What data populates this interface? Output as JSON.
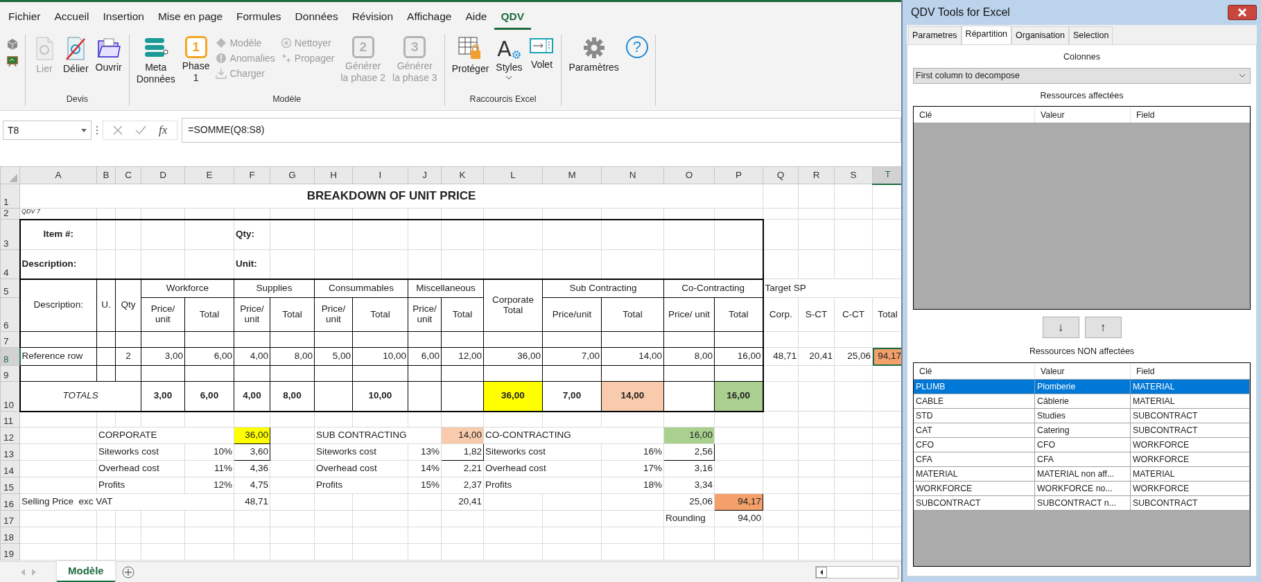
{
  "menu_tabs": [
    {
      "label": "Fichier",
      "selected": false
    },
    {
      "label": "Accueil",
      "selected": false
    },
    {
      "label": "Insertion",
      "selected": false
    },
    {
      "label": "Mise en page",
      "selected": false
    },
    {
      "label": "Formules",
      "selected": false
    },
    {
      "label": "Données",
      "selected": false
    },
    {
      "label": "Révision",
      "selected": false
    },
    {
      "label": "Affichage",
      "selected": false
    },
    {
      "label": "Aide",
      "selected": false
    },
    {
      "label": "QDV",
      "selected": true
    }
  ],
  "ribbon": {
    "groups": [
      {
        "buttons": [
          {
            "kind": "tiny",
            "disabled": false
          },
          {
            "kind": "tiny",
            "disabled": false
          }
        ]
      },
      {
        "label": "Devis",
        "buttons": [
          {
            "kind": "large",
            "label": "Lier",
            "disabled": true
          },
          {
            "kind": "large",
            "label": "Délier",
            "disabled": false
          },
          {
            "kind": "large",
            "label": "Ouvrir",
            "disabled": false
          }
        ]
      },
      {
        "label": "Modèle",
        "buttons": [
          {
            "kind": "large",
            "label": "Meta\nDonnées",
            "disabled": false
          },
          {
            "kind": "large",
            "label": "Phase\n1",
            "glyph": "1",
            "disabled": false
          },
          {
            "kind": "small",
            "label": "Modèle",
            "disabled": true
          },
          {
            "kind": "small",
            "label": "Anomalies",
            "disabled": true
          },
          {
            "kind": "small",
            "label": "Charger",
            "disabled": true
          },
          {
            "kind": "small",
            "label": "Nettoyer",
            "disabled": true
          },
          {
            "kind": "small",
            "label": "Propager",
            "disabled": true
          },
          {
            "kind": "large",
            "label": "Générer\nla phase 2",
            "glyph": "2",
            "disabled": true
          },
          {
            "kind": "large",
            "label": "Générer\nla phase 3",
            "glyph": "3",
            "disabled": true
          }
        ]
      },
      {
        "label": "Raccourcis Excel",
        "buttons": [
          {
            "kind": "large",
            "label": "Protéger",
            "disabled": false
          },
          {
            "kind": "large",
            "label": "Styles",
            "glyph": "A",
            "dropdown": true,
            "disabled": false
          },
          {
            "kind": "large",
            "label": "Volet",
            "disabled": false
          }
        ]
      },
      {
        "buttons": [
          {
            "kind": "large",
            "label": "Paramètres",
            "disabled": false
          },
          {
            "kind": "large",
            "glyph": "?",
            "disabled": false
          }
        ]
      }
    ]
  },
  "formula_bar": {
    "name_box": "T8",
    "function_label": "fx",
    "formula": "=SOMME(Q8:S8)"
  },
  "sheet": {
    "columns": [
      {
        "label": "A",
        "selected": false
      },
      {
        "label": "B",
        "selected": false
      },
      {
        "label": "C",
        "selected": false
      },
      {
        "label": "D",
        "selected": false
      },
      {
        "label": "E",
        "selected": false
      },
      {
        "label": "F",
        "selected": false
      },
      {
        "label": "G",
        "selected": false
      },
      {
        "label": "H",
        "selected": false
      },
      {
        "label": "I",
        "selected": false
      },
      {
        "label": "J",
        "selected": false
      },
      {
        "label": "K",
        "selected": false
      },
      {
        "label": "L",
        "selected": false
      },
      {
        "label": "M",
        "selected": false
      },
      {
        "label": "N",
        "selected": false
      },
      {
        "label": "O",
        "selected": false
      },
      {
        "label": "P",
        "selected": false
      },
      {
        "label": "Q",
        "selected": false
      },
      {
        "label": "R",
        "selected": false
      },
      {
        "label": "S",
        "selected": false
      },
      {
        "label": "T",
        "selected": true
      }
    ],
    "rows": [
      {
        "label": "1",
        "kind": "title",
        "selected": false,
        "cells": [
          {
            "text": "BREAKDOWN OF UNIT PRICE",
            "kind": "heading",
            "bold": true
          }
        ]
      },
      {
        "label": "2",
        "kind": "note",
        "selected": false,
        "cells": [
          {
            "text": "QDV 7",
            "kind": "label",
            "italic": true
          }
        ]
      },
      {
        "label": "3",
        "kind": "form",
        "selected": false,
        "cells": [
          {
            "text": "Item #:",
            "kind": "caption",
            "bold": true
          },
          "",
          "",
          "",
          "",
          {
            "text": "Qty:",
            "kind": "label",
            "bold": true
          }
        ]
      },
      {
        "label": "4",
        "kind": "form",
        "selected": false,
        "cells": [
          {
            "text": "Description:",
            "kind": "label",
            "bold": true
          },
          "",
          "",
          "",
          "",
          {
            "text": "Unit:",
            "kind": "label",
            "bold": true
          }
        ]
      },
      {
        "label": "5",
        "kind": "header",
        "selected": false,
        "cells": [
          {
            "text": "Description:",
            "kind": "heading"
          },
          {
            "text": "U.",
            "kind": "heading"
          },
          {
            "text": "Qty",
            "kind": "heading"
          },
          {
            "text": "Workforce",
            "kind": "heading"
          },
          "",
          {
            "text": "Supplies",
            "kind": "heading"
          },
          "",
          {
            "text": "Consummables",
            "kind": "heading"
          },
          "",
          {
            "text": "Miscellaneous",
            "kind": "heading"
          },
          "",
          {
            "text": "Corporate Total",
            "kind": "heading"
          },
          {
            "text": "Sub Contracting",
            "kind": "heading"
          },
          "",
          {
            "text": "Co-Contracting",
            "kind": "heading"
          },
          "",
          "Target SP"
        ]
      },
      {
        "label": "6",
        "kind": "header",
        "selected": false,
        "cells": [
          "",
          "",
          "",
          {
            "text": "Price/ unit",
            "kind": "heading"
          },
          {
            "text": "Total",
            "kind": "heading"
          },
          {
            "text": "Price/ unit",
            "kind": "heading"
          },
          {
            "text": "Total",
            "kind": "heading"
          },
          {
            "text": "Price/ unit",
            "kind": "heading"
          },
          {
            "text": "Total",
            "kind": "heading"
          },
          {
            "text": "Price/ unit",
            "kind": "heading"
          },
          {
            "text": "Total",
            "kind": "heading"
          },
          "",
          {
            "text": "Price/unit",
            "kind": "heading"
          },
          {
            "text": "Total",
            "kind": "heading"
          },
          {
            "text": "Price/ unit",
            "kind": "heading"
          },
          {
            "text": "Total",
            "kind": "heading"
          },
          {
            "text": "Corp.",
            "kind": "heading"
          },
          {
            "text": "S-CT",
            "kind": "heading"
          },
          {
            "text": "C-CT",
            "kind": "heading"
          },
          {
            "text": "Total",
            "kind": "heading"
          }
        ]
      },
      {
        "label": "7",
        "kind": "blank",
        "selected": false
      },
      {
        "label": "8",
        "kind": "data",
        "selected": true,
        "cells": [
          "Reference row",
          "",
          {
            "text": "2",
            "kind": "caption"
          },
          {
            "text": "3,00",
            "kind": "number"
          },
          {
            "text": "6,00",
            "kind": "number"
          },
          {
            "text": "4,00",
            "kind": "number"
          },
          {
            "text": "8,00",
            "kind": "number"
          },
          {
            "text": "5,00",
            "kind": "number"
          },
          {
            "text": "10,00",
            "kind": "number"
          },
          {
            "text": "6,00",
            "kind": "number"
          },
          {
            "text": "12,00",
            "kind": "number"
          },
          {
            "text": "36,00",
            "kind": "number"
          },
          {
            "text": "7,00",
            "kind": "number"
          },
          {
            "text": "14,00",
            "kind": "number"
          },
          {
            "text": "8,00",
            "kind": "number"
          },
          {
            "text": "16,00",
            "kind": "number"
          },
          {
            "text": "48,71",
            "kind": "number"
          },
          {
            "text": "20,41",
            "kind": "number"
          },
          {
            "text": "25,06",
            "kind": "number"
          },
          {
            "text": "94,17",
            "kind": "number",
            "color": "#f4a06a"
          }
        ]
      },
      {
        "label": "9",
        "kind": "blank",
        "selected": false
      },
      {
        "label": "10",
        "kind": "totals",
        "selected": false,
        "cells": [
          {
            "text": "TOTALS",
            "kind": "heading",
            "italic": true
          },
          "",
          "",
          {
            "text": "3,00",
            "kind": "total"
          },
          {
            "text": "6,00",
            "kind": "total"
          },
          {
            "text": "4,00",
            "kind": "total"
          },
          {
            "text": "8,00",
            "kind": "total"
          },
          "",
          {
            "text": "10,00",
            "kind": "total"
          },
          "",
          "",
          {
            "text": "36,00",
            "kind": "total",
            "color": "#ffff00"
          },
          {
            "text": "7,00",
            "kind": "total"
          },
          {
            "text": "14,00",
            "kind": "total",
            "color": "#f8cbad"
          },
          "",
          {
            "text": "16,00",
            "kind": "total",
            "color": "#a9d08e"
          }
        ]
      },
      {
        "label": "11",
        "kind": "plain",
        "selected": false
      },
      {
        "label": "12",
        "kind": "plain",
        "selected": false,
        "cells": [
          "",
          "CORPORATE",
          "",
          "",
          "",
          {
            "text": "36,00",
            "kind": "number",
            "color": "#ffff00",
            "boxed": true
          },
          "",
          "SUB CONTRACTING",
          "",
          "",
          {
            "text": "14,00",
            "kind": "number",
            "color": "#f8cbad"
          },
          "CO-CONTRACTING",
          "",
          "",
          {
            "text": "16,00",
            "kind": "number",
            "color": "#a9d08e"
          }
        ]
      },
      {
        "label": "13",
        "kind": "plain",
        "selected": false,
        "cells": [
          "",
          "Siteworks cost",
          "",
          "",
          {
            "text": "10%",
            "kind": "number"
          },
          {
            "text": "3,60",
            "kind": "number",
            "boxed": true
          },
          "",
          "Siteworks cost",
          "",
          {
            "text": "13%",
            "kind": "number"
          },
          {
            "text": "1,82",
            "kind": "number",
            "boxed": true
          },
          "Siteworks cost",
          "",
          {
            "text": "16%",
            "kind": "number"
          },
          {
            "text": "2,56",
            "kind": "number",
            "boxed": true
          }
        ]
      },
      {
        "label": "14",
        "kind": "plain",
        "selected": false,
        "cells": [
          "",
          "Overhead cost",
          "",
          "",
          {
            "text": "11%",
            "kind": "number"
          },
          {
            "text": "4,36",
            "kind": "number"
          },
          "",
          "Overhead cost",
          "",
          {
            "text": "14%",
            "kind": "number"
          },
          {
            "text": "2,21",
            "kind": "number"
          },
          "Overhead cost",
          "",
          {
            "text": "17%",
            "kind": "number"
          },
          {
            "text": "3,16",
            "kind": "number"
          }
        ]
      },
      {
        "label": "15",
        "kind": "plain",
        "selected": false,
        "cells": [
          "",
          "Profits",
          "",
          "",
          {
            "text": "12%",
            "kind": "number"
          },
          {
            "text": "4,75",
            "kind": "number"
          },
          "",
          "Profits",
          "",
          {
            "text": "15%",
            "kind": "number"
          },
          {
            "text": "2,37",
            "kind": "number"
          },
          "Profits",
          "",
          {
            "text": "18%",
            "kind": "number"
          },
          {
            "text": "3,34",
            "kind": "number"
          }
        ]
      },
      {
        "label": "16",
        "kind": "plain",
        "selected": false,
        "cells": [
          "Selling Price  exc VAT",
          "",
          "",
          "",
          "",
          {
            "text": "48,71",
            "kind": "number"
          },
          "",
          "",
          "",
          "",
          {
            "text": "20,41",
            "kind": "number"
          },
          "",
          "",
          "",
          {
            "text": "25,06",
            "kind": "number"
          },
          {
            "text": "94,17",
            "kind": "number",
            "color": "#f4a06a",
            "boxed": true
          }
        ]
      },
      {
        "label": "17",
        "kind": "plain",
        "selected": false,
        "cells": [
          "",
          "",
          "",
          "",
          "",
          "",
          "",
          "",
          "",
          "",
          "",
          "",
          "",
          "",
          "Rounding",
          {
            "text": "94,00",
            "kind": "number"
          }
        ]
      },
      {
        "label": "18",
        "kind": "plain",
        "selected": false
      },
      {
        "label": "19",
        "kind": "plain",
        "selected": false
      }
    ]
  },
  "sheet_tabs": [
    {
      "label": "Modèle",
      "selected": true
    }
  ],
  "panel": {
    "title": "QDV Tools for Excel",
    "tabs": [
      {
        "label": "Parametres",
        "selected": false
      },
      {
        "label": "Répartition",
        "selected": true
      },
      {
        "label": "Organisation",
        "selected": false
      },
      {
        "label": "Selection",
        "selected": false
      }
    ],
    "columns_label": "Colonnes",
    "column_select": "First column to decompose",
    "assigned": {
      "label": "Ressources affectées",
      "columns": [
        "Clé",
        "Valeur",
        "Field"
      ]
    },
    "move_buttons": [
      "↓",
      "↑"
    ],
    "unassigned": {
      "label": "Ressources NON affectées",
      "columns": [
        "Clé",
        "Valeur",
        "Field"
      ],
      "rows": [
        {
          "cells": [
            "PLUMB",
            "Plomberie",
            "MATERIAL"
          ],
          "selected": true
        },
        {
          "cells": [
            "CABLE",
            "Câblerie",
            "MATERIAL"
          ],
          "selected": false
        },
        {
          "cells": [
            "STD",
            "Studies",
            "SUBCONTRACT"
          ],
          "selected": false
        },
        {
          "cells": [
            "CAT",
            "Catering",
            "SUBCONTRACT"
          ],
          "selected": false
        },
        {
          "cells": [
            "CFO",
            "CFO",
            "WORKFORCE"
          ],
          "selected": false
        },
        {
          "cells": [
            "CFA",
            "CFA",
            "WORKFORCE"
          ],
          "selected": false
        },
        {
          "cells": [
            "MATERIAL",
            "MATERIAL non aff...",
            "MATERIAL"
          ],
          "selected": false
        },
        {
          "cells": [
            "WORKFORCE",
            "WORKFORCE no...",
            "WORKFORCE"
          ],
          "selected": false
        },
        {
          "cells": [
            "SUBCONTRACT",
            "SUBCONTRACT n...",
            "SUBCONTRACT"
          ],
          "selected": false
        }
      ]
    }
  }
}
